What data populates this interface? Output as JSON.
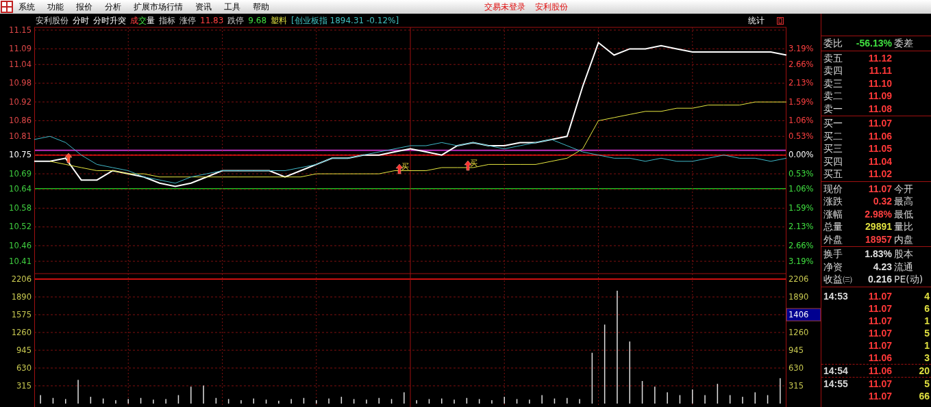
{
  "menu": {
    "items": [
      "系统",
      "功能",
      "报价",
      "分析",
      "扩展市场行情",
      "资讯",
      "工具",
      "帮助"
    ],
    "status": [
      "交易未登录",
      "安利股份"
    ]
  },
  "info_bar": {
    "items": [
      {
        "text": "安利股份",
        "kind": "label"
      },
      {
        "text": "分时",
        "kind": "tab"
      },
      {
        "text": "分时升突",
        "kind": "tab"
      },
      {
        "parts": [
          {
            "text": "成",
            "kind": "rise"
          },
          {
            "text": "交",
            "kind": "fall"
          },
          {
            "text": "量",
            "kind": "tab"
          }
        ]
      },
      {
        "text": "指标",
        "kind": "label"
      },
      {
        "text": "涨停",
        "kind": "label"
      },
      {
        "text": "11.83",
        "kind": "rise"
      },
      {
        "text": "跌停",
        "kind": "label"
      },
      {
        "text": "9.68",
        "kind": "fall"
      },
      {
        "text": "塑料",
        "kind": "sector"
      },
      {
        "text": "[创业板指 1894.31 -0.12%]",
        "kind": "index"
      }
    ],
    "stats": "统计"
  },
  "price_chart": {
    "chart_data": {
      "type": "line",
      "ylim": [
        10.41,
        11.15
      ],
      "yticks": [
        11.15,
        11.09,
        11.04,
        10.98,
        10.92,
        10.86,
        10.81,
        10.75,
        10.69,
        10.64,
        10.58,
        10.52,
        10.46,
        10.41
      ],
      "grid": true,
      "categories": [
        null,
        null,
        null,
        null,
        null,
        null,
        null,
        null,
        null,
        null,
        null,
        null,
        null,
        null,
        null,
        null,
        null,
        null,
        null,
        null,
        null,
        null,
        null,
        null,
        null,
        null,
        null,
        null,
        null,
        null,
        null,
        null,
        null,
        null,
        null,
        null,
        null,
        null,
        null,
        null,
        null,
        null,
        null,
        null,
        null,
        null,
        null,
        null,
        null
      ],
      "series": [
        {
          "color": "#ffffff",
          "values": [
            10.73,
            10.73,
            10.74,
            10.67,
            10.67,
            10.7,
            10.69,
            10.68,
            10.66,
            10.65,
            10.66,
            10.68,
            10.7,
            10.7,
            10.7,
            10.7,
            10.68,
            10.7,
            10.72,
            10.74,
            10.74,
            10.75,
            10.75,
            10.76,
            10.77,
            10.76,
            10.75,
            10.78,
            10.79,
            10.78,
            10.78,
            10.79,
            10.79,
            10.8,
            10.81,
            10.97,
            11.11,
            11.07,
            11.09,
            11.09,
            11.1,
            11.09,
            11.08,
            11.08,
            11.08,
            11.08,
            11.08,
            11.08,
            11.07
          ]
        },
        {
          "color": "#e8e840",
          "values": [
            null,
            10.73,
            10.72,
            10.71,
            10.7,
            10.7,
            10.69,
            10.69,
            10.68,
            10.68,
            10.68,
            10.68,
            10.68,
            10.68,
            10.68,
            10.68,
            10.68,
            10.68,
            10.69,
            10.69,
            10.69,
            10.69,
            10.69,
            10.7,
            10.7,
            10.7,
            10.71,
            10.71,
            10.71,
            10.72,
            10.72,
            10.72,
            10.72,
            10.73,
            10.74,
            10.77,
            10.86,
            10.87,
            10.88,
            10.89,
            10.89,
            10.9,
            10.9,
            10.91,
            10.91,
            10.91,
            10.92,
            10.92,
            10.92
          ]
        },
        {
          "color": "#40b8c8",
          "values": [
            10.8,
            10.81,
            10.79,
            10.75,
            10.72,
            10.71,
            10.7,
            10.68,
            10.67,
            10.66,
            10.68,
            10.69,
            10.7,
            10.7,
            10.7,
            10.7,
            10.7,
            10.71,
            10.72,
            10.74,
            10.74,
            10.75,
            10.76,
            10.77,
            10.78,
            10.78,
            10.79,
            10.78,
            10.79,
            10.78,
            10.77,
            10.78,
            10.79,
            10.8,
            10.78,
            10.76,
            10.75,
            10.74,
            10.74,
            10.73,
            10.74,
            10.73,
            10.73,
            10.74,
            10.75,
            10.74,
            10.74,
            10.73,
            10.74
          ]
        }
      ]
    }
  },
  "markers": [
    {
      "kind": "arrow"
    },
    {
      "kind": "buy",
      "label": "买"
    },
    {
      "kind": "buy",
      "label": "买"
    }
  ],
  "percent_axis": [
    {
      "label": "3.19%",
      "kind": "rise"
    },
    {
      "label": "2.66%",
      "kind": "rise"
    },
    {
      "label": "2.13%",
      "kind": "rise"
    },
    {
      "label": "1.59%",
      "kind": "rise"
    },
    {
      "label": "1.06%",
      "kind": "rise"
    },
    {
      "label": "0.53%",
      "kind": "rise"
    },
    {
      "label": "0.00%",
      "kind": "zero"
    },
    {
      "label": "0.53%",
      "kind": "fall"
    },
    {
      "label": "1.06%",
      "kind": "fall"
    },
    {
      "label": "1.59%",
      "kind": "fall"
    },
    {
      "label": "2.13%",
      "kind": "fall"
    },
    {
      "label": "2.66%",
      "kind": "fall"
    },
    {
      "label": "3.19%",
      "kind": "fall"
    }
  ],
  "volume_chart": {
    "chart_data": {
      "type": "bar",
      "ylim": [
        0,
        2206
      ],
      "grid": true,
      "yticks": [
        2206,
        1890,
        1575,
        1260,
        945,
        630,
        315
      ],
      "categories": [
        null,
        null,
        null,
        null,
        null,
        null,
        null,
        null,
        null,
        null,
        null,
        null,
        null,
        null,
        null,
        null,
        null,
        null,
        null,
        null,
        null,
        null,
        null,
        null,
        null,
        null,
        null,
        null,
        null,
        null,
        null,
        null,
        null,
        null,
        null,
        null,
        null,
        null,
        null,
        null,
        null,
        null,
        null,
        null,
        null,
        null,
        null,
        null,
        null,
        null,
        null,
        null,
        null,
        null,
        null,
        null,
        null,
        null,
        null,
        null
      ],
      "series": [
        {
          "color": "#e0e0e0",
          "values": [
            150,
            100,
            80,
            420,
            120,
            90,
            60,
            80,
            100,
            70,
            80,
            150,
            300,
            320,
            100,
            80,
            60,
            90,
            70,
            50,
            80,
            100,
            60,
            90,
            120,
            80,
            70,
            100,
            80,
            200,
            60,
            80,
            90,
            70,
            100,
            80,
            60,
            120,
            80,
            70,
            150,
            90,
            100,
            80,
            900,
            1400,
            2000,
            1100,
            400,
            300,
            200,
            150,
            250,
            150,
            350,
            150,
            120,
            200,
            150,
            450
          ]
        }
      ]
    }
  },
  "volume_axis_right": [
    {
      "label": "2206",
      "kind": "tick"
    },
    {
      "label": "1890",
      "kind": "tick"
    },
    {
      "label": "1406",
      "kind": "cursor"
    },
    {
      "label": "1260",
      "kind": "tick"
    },
    {
      "label": "945",
      "kind": "tick"
    },
    {
      "label": "630",
      "kind": "tick"
    },
    {
      "label": "315",
      "kind": "tick"
    }
  ],
  "order_book": {
    "ratio": {
      "label": "委比",
      "value": "-56.13%",
      "label2": "委差",
      "kind": "fall"
    },
    "asks": [
      {
        "label": "卖五",
        "price": "11.12"
      },
      {
        "label": "卖四",
        "price": "11.11"
      },
      {
        "label": "卖三",
        "price": "11.10"
      },
      {
        "label": "卖二",
        "price": "11.09"
      },
      {
        "label": "卖一",
        "price": "11.08"
      }
    ],
    "bids": [
      {
        "label": "买一",
        "price": "11.07"
      },
      {
        "label": "买二",
        "price": "11.06"
      },
      {
        "label": "买三",
        "price": "11.05"
      },
      {
        "label": "买四",
        "price": "11.04"
      },
      {
        "label": "买五",
        "price": "11.02"
      }
    ]
  },
  "quote": [
    {
      "label": "现价",
      "value": "11.07",
      "label2": "今开",
      "kind": "rise"
    },
    {
      "label": "涨跌",
      "value": "0.32",
      "label2": "最高",
      "kind": "rise"
    },
    {
      "label": "涨幅",
      "value": "2.98%",
      "label2": "最低",
      "kind": "rise"
    },
    {
      "label": "总量",
      "value": "29891",
      "label2": "量比",
      "kind": "volume"
    },
    {
      "label": "外盘",
      "value": "18957",
      "label2": "内盘",
      "kind": "rise"
    }
  ],
  "fundamentals": [
    {
      "label": "换手",
      "value": "1.83%",
      "label2": "股本"
    },
    {
      "label": "净资",
      "value": "4.23",
      "label2": "流通"
    },
    {
      "label": "收益㈢",
      "value": "0.216",
      "label2": "PE(动)"
    }
  ],
  "ticks": [
    {
      "time": "14:53",
      "price": "11.07",
      "volume": "4"
    },
    {
      "price": "11.07",
      "volume": "6"
    },
    {
      "price": "11.07",
      "volume": "1"
    },
    {
      "price": "11.07",
      "volume": "5"
    },
    {
      "price": "11.07",
      "volume": "1"
    },
    {
      "price": "11.06",
      "volume": "3"
    },
    {
      "time": "14:54",
      "price": "11.06",
      "volume": "20"
    },
    {
      "time": "14:55",
      "price": "11.07",
      "volume": "5"
    },
    {
      "price": "11.07",
      "volume": "66"
    }
  ]
}
